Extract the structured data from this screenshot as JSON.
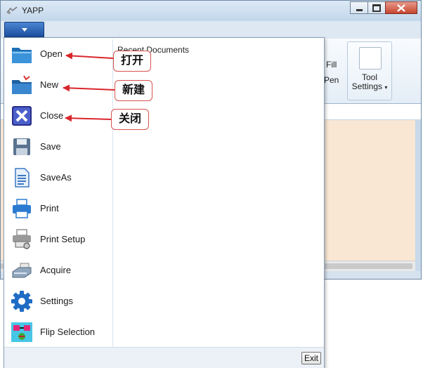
{
  "window": {
    "title": "YAPP",
    "controls": [
      "minimize",
      "maximize",
      "close"
    ]
  },
  "ribbon": {
    "fill_label": "Fill",
    "pen_label": "Pen",
    "tool_settings": {
      "line1": "Tool",
      "line2": "Settings",
      "has_dropdown": true
    }
  },
  "app_menu": {
    "recent_documents_label": "Recent Documents",
    "exit_label": "Exit",
    "items": [
      {
        "label": "Open",
        "icon": "open-folder-icon"
      },
      {
        "label": "New",
        "icon": "new-folder-icon"
      },
      {
        "label": "Close",
        "icon": "close-x-icon"
      },
      {
        "label": "Save",
        "icon": "save-disk-icon"
      },
      {
        "label": "SaveAs",
        "icon": "save-as-document-icon"
      },
      {
        "label": "Print",
        "icon": "printer-icon"
      },
      {
        "label": "Print Setup",
        "icon": "print-setup-icon"
      },
      {
        "label": "Acquire",
        "icon": "scanner-icon"
      },
      {
        "label": "Settings",
        "icon": "gear-icon"
      },
      {
        "label": "Flip Selection",
        "icon": "flip-selection-icon"
      }
    ]
  },
  "annotations": [
    {
      "text": "打开",
      "target": "Open"
    },
    {
      "text": "新建",
      "target": "New"
    },
    {
      "text": "关闭",
      "target": "Close"
    }
  ],
  "colors": {
    "canvas": "#f9e7d3",
    "app_button": "#2a63b8",
    "annotation_arrow": "#d9262c"
  }
}
